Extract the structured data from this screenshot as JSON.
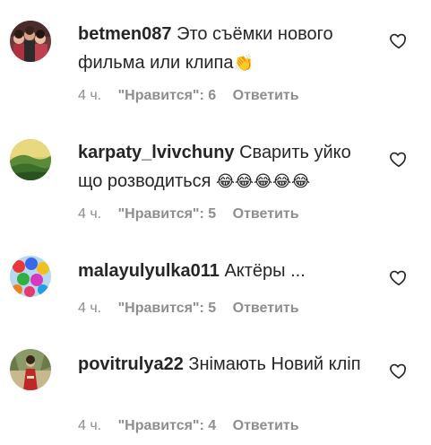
{
  "comments": [
    {
      "username": "betmen087",
      "text": "Это съёмки нового фильма или клипа",
      "emoji": "👏",
      "time": "4 ч.",
      "likes": "\"Нравится\": 6",
      "reply": "Ответить",
      "avatar_icon": "group-photo-avatar"
    },
    {
      "username": "karpaty_lvivchuny",
      "text": "Сварить уйко що розводиться",
      "emoji": "😂😂😂😂😂",
      "time": "4 ч.",
      "likes": "\"Нравится\": 5",
      "reply": "Ответить",
      "avatar_icon": "landscape-avatar"
    },
    {
      "username": "malayulyulka011",
      "text": "Актёры ...",
      "emoji": "",
      "time": "4 ч.",
      "likes": "\"Нравится\": 5",
      "reply": "Ответить",
      "avatar_icon": "balloons-avatar"
    },
    {
      "username": "povitrulya22",
      "text": "Знімають Новий кліп",
      "emoji": "",
      "time": "4 ч.",
      "likes": "\"Нравится\": 4",
      "reply": "Ответить",
      "avatar_icon": "person-avatar"
    }
  ],
  "colors": {
    "text": "#262626",
    "secondary": "#8e8e8e",
    "background": "#ffffff"
  }
}
